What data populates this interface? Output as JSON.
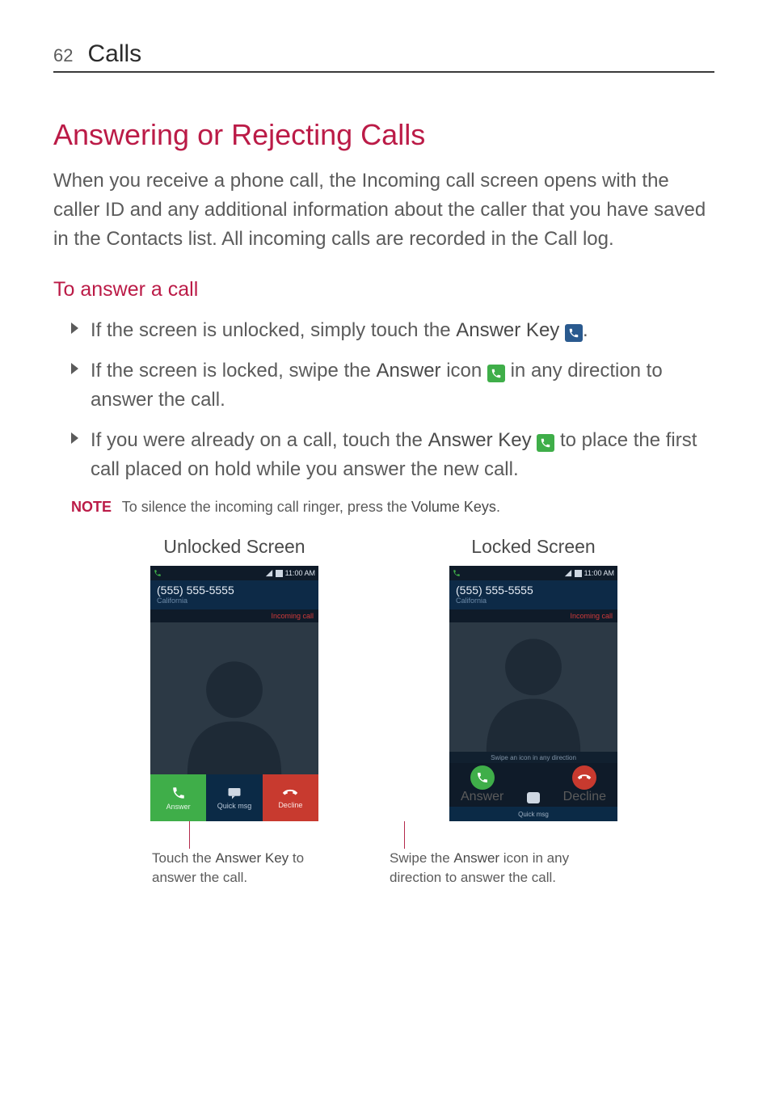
{
  "header": {
    "page_number": "62",
    "section": "Calls"
  },
  "h1": "Answering or Rejecting Calls",
  "intro": "When you receive a phone call, the Incoming call screen opens with the caller ID and any additional information about the caller that you have saved in the Contacts list. All incoming calls are recorded in the Call log.",
  "h2": "To answer a call",
  "bullet1": {
    "pre": "If the screen is unlocked, simply touch the ",
    "bold": "Answer Key",
    "post": "."
  },
  "bullet2": {
    "pre": "If the screen is locked, swipe the ",
    "bold": "Answer",
    "mid": " icon ",
    "post": " in any direction to answer the call."
  },
  "bullet3": {
    "pre": "If you were already on a call, touch the ",
    "bold": "Answer Key",
    "post": " to place the first call placed on hold while you answer the new call."
  },
  "note": {
    "label": "NOTE",
    "pre": " To silence the incoming call ringer, press the ",
    "bold": "Volume Keys",
    "post": "."
  },
  "screens": {
    "unlocked_title": "Unlocked Screen",
    "locked_title": "Locked Screen"
  },
  "phone": {
    "time": "11:00 AM",
    "number": "(555) 555-5555",
    "location": "California",
    "incoming": "Incoming call",
    "answer": "Answer",
    "quick_msg": "Quick msg",
    "decline": "Decline",
    "swipe_hint": "Swipe an icon in any direction"
  },
  "callouts": {
    "unlocked": {
      "pre": "Touch the ",
      "bold": "Answer Key",
      "post": " to answer the call."
    },
    "locked": {
      "pre": "Swipe the ",
      "bold": "Answer",
      "post": " icon in any direction to answer the call."
    }
  }
}
